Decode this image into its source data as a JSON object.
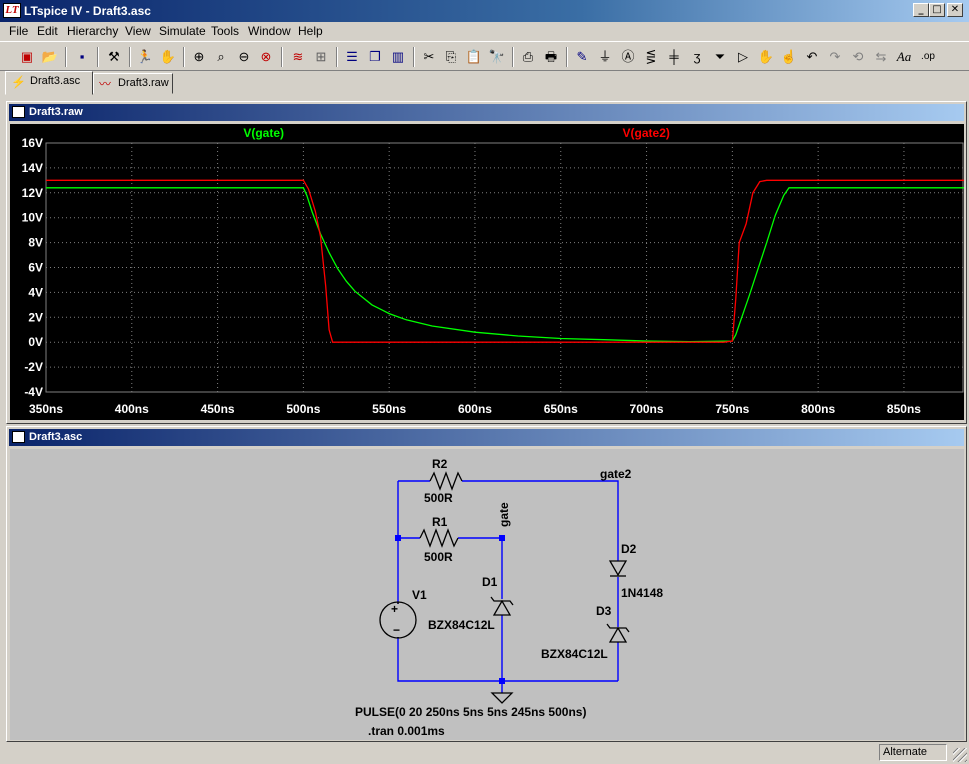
{
  "window": {
    "title": "LTspice IV - Draft3.asc",
    "app_icon": "ltspice-logo-icon"
  },
  "menu": [
    "File",
    "Edit",
    "Hierarchy",
    "View",
    "Simulate",
    "Tools",
    "Window",
    "Help"
  ],
  "toolbar": [
    "new-schematic-icon",
    "open-icon",
    "save-icon",
    "control-panel-icon",
    "run-icon",
    "halt-icon",
    "zoom-in-icon",
    "zoom-rubber-icon",
    "zoom-out-icon",
    "zoom-cancel-icon",
    "autorange-icon",
    "grid-icon",
    "tile-horizontal-icon",
    "cascade-icon",
    "tile-vertical-icon",
    "cut-icon",
    "copy-icon",
    "paste-icon",
    "find-icon",
    "print-setup-icon",
    "print-icon",
    "draw-wire-icon",
    "ground-icon",
    "label-net-icon",
    "resistor-icon",
    "capacitor-icon",
    "inductor-icon",
    "diode-icon",
    "component-icon",
    "move-icon",
    "drag-icon",
    "undo-icon",
    "redo-icon",
    "rotate-icon",
    "mirror-icon",
    "text-icon",
    "spice-directive-icon"
  ],
  "tabs": [
    {
      "label": "Draft3.asc",
      "icon": "schematic-icon",
      "active": true
    },
    {
      "label": "Draft3.raw",
      "icon": "waveform-icon",
      "active": false
    }
  ],
  "waveform_window": {
    "title": "Draft3.raw"
  },
  "schematic_window": {
    "title": "Draft3.asc"
  },
  "chart_data": {
    "type": "line",
    "title": "",
    "xlabel": "",
    "ylabel": "",
    "xlim": [
      350,
      885
    ],
    "ylim": [
      -4,
      16
    ],
    "x_ticks": [
      "350ns",
      "400ns",
      "450ns",
      "500ns",
      "550ns",
      "600ns",
      "650ns",
      "700ns",
      "750ns",
      "800ns",
      "850ns"
    ],
    "y_ticks": [
      "16V",
      "14V",
      "12V",
      "10V",
      "8V",
      "6V",
      "4V",
      "2V",
      "0V",
      "-2V",
      "-4V"
    ],
    "grid": true,
    "legend": "top",
    "series": [
      {
        "name": "V(gate)",
        "color": "#00ff00",
        "x": [
          350,
          500,
          502,
          505,
          510,
          515,
          520,
          525,
          530,
          540,
          550,
          560,
          575,
          600,
          625,
          650,
          675,
          700,
          725,
          750,
          752,
          755,
          760,
          765,
          770,
          775,
          780,
          783,
          885
        ],
        "y": [
          12.4,
          12.4,
          11.8,
          10.5,
          8.7,
          7.2,
          5.9,
          4.9,
          4.1,
          3.0,
          2.3,
          1.8,
          1.3,
          0.8,
          0.5,
          0.3,
          0.2,
          0.1,
          0.05,
          0.1,
          0.6,
          1.8,
          3.8,
          5.9,
          8.0,
          10.2,
          11.8,
          12.4,
          12.4
        ]
      },
      {
        "name": "V(gate2)",
        "color": "#ff0000",
        "x": [
          350,
          500,
          503,
          507,
          510,
          513,
          515,
          517,
          520,
          700,
          745,
          750,
          752,
          754,
          758,
          762,
          766,
          770,
          885
        ],
        "y": [
          13.0,
          13.0,
          12.3,
          10.5,
          8.5,
          4.5,
          1.0,
          0.0,
          0.0,
          0.0,
          0.0,
          0.1,
          3.5,
          8.0,
          9.5,
          12.0,
          12.9,
          13.0,
          13.0
        ]
      }
    ]
  },
  "schematic": {
    "components": {
      "r2_name": "R2",
      "r2_value": "500R",
      "r1_name": "R1",
      "r1_value": "500R",
      "v1_name": "V1",
      "d1_name": "D1",
      "d1_value": "BZX84C12L",
      "d2_name": "D2",
      "d2_value": "1N4148",
      "d3_name": "D3",
      "d3_value": "BZX84C12L"
    },
    "nets": {
      "gate": "gate",
      "gate2": "gate2"
    },
    "source_value": "PULSE(0 20 250ns 5ns 5ns 245ns 500ns)",
    "directive": ".tran 0.001ms"
  },
  "status": {
    "mode": "Alternate"
  }
}
